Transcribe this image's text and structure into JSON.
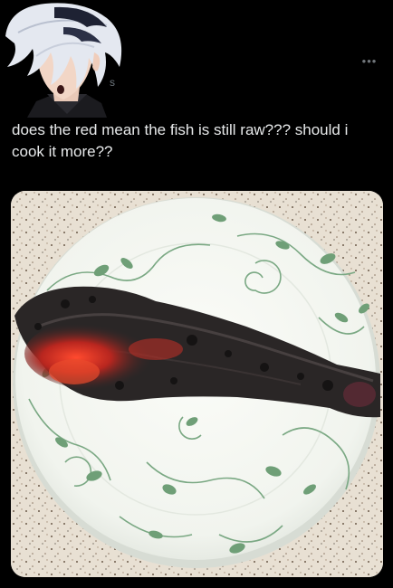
{
  "post": {
    "username_fragment": "s",
    "more_label": "•••",
    "text": "does the red mean the fish is still raw??? should i cook it more??"
  },
  "colors": {
    "background": "#000000",
    "text": "#e7e9ea",
    "muted": "#71767b",
    "plate": "#f4f6f1",
    "vine": "#6f9f77",
    "counter": "#e6ded1",
    "char": "#2a2626",
    "ember": "#e63a2e"
  },
  "icons": {
    "more": "more-horizontal-icon"
  }
}
